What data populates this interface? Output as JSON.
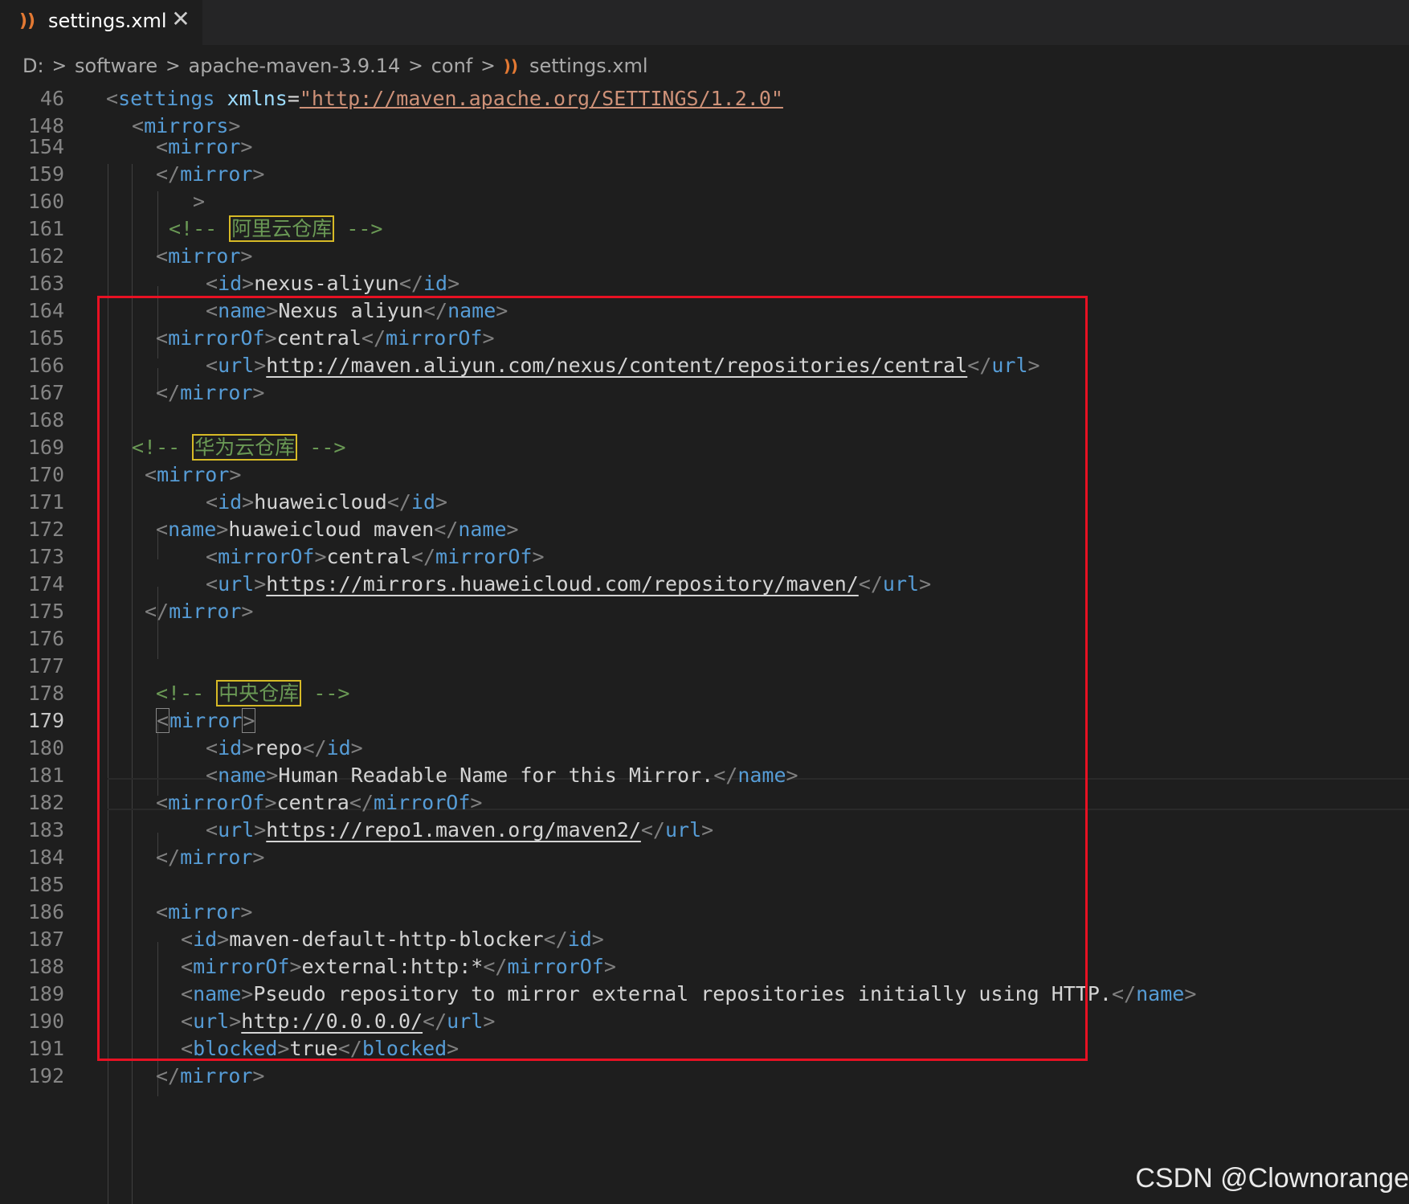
{
  "tab": {
    "icon": "rss-icon",
    "label": "settings.xml",
    "close": "✕"
  },
  "breadcrumb": {
    "parts": [
      "D:",
      "software",
      "apache-maven-3.9.14",
      "conf"
    ],
    "file": "settings.xml"
  },
  "lines": [
    {
      "n": "46"
    },
    {
      "n": "148"
    },
    {
      "n": "154"
    },
    {
      "n": "159"
    },
    {
      "n": "160"
    },
    {
      "n": "161"
    },
    {
      "n": "162"
    },
    {
      "n": "163"
    },
    {
      "n": "164"
    },
    {
      "n": "165"
    },
    {
      "n": "166"
    },
    {
      "n": "167"
    },
    {
      "n": "168"
    },
    {
      "n": "169"
    },
    {
      "n": "170"
    },
    {
      "n": "171"
    },
    {
      "n": "172"
    },
    {
      "n": "173"
    },
    {
      "n": "174"
    },
    {
      "n": "175"
    },
    {
      "n": "176"
    },
    {
      "n": "177"
    },
    {
      "n": "178"
    },
    {
      "n": "179"
    },
    {
      "n": "180"
    },
    {
      "n": "181"
    },
    {
      "n": "182"
    },
    {
      "n": "183"
    },
    {
      "n": "184"
    },
    {
      "n": "185"
    },
    {
      "n": "186"
    },
    {
      "n": "187"
    },
    {
      "n": "188"
    },
    {
      "n": "189"
    },
    {
      "n": "190"
    },
    {
      "n": "191"
    },
    {
      "n": "192"
    }
  ],
  "code": {
    "settings_tag": "settings",
    "xmlns_attr": "xmlns",
    "xmlns_value": "\"http://maven.apache.org/SETTINGS/1.2.0\"",
    "mirrors": "mirrors",
    "mirror": "mirror",
    "id": "id",
    "name": "name",
    "mirrorOf": "mirrorOf",
    "url": "url",
    "blocked": "blocked",
    "stray": ">",
    "comment_open": "<!-- ",
    "comment_close": " -->",
    "aliyun_comment": "阿里云仓库",
    "aliyun_id": "nexus-aliyun",
    "aliyun_name": "Nexus aliyun",
    "aliyun_of": "central",
    "aliyun_url": "http://maven.aliyun.com/nexus/content/repositories/central",
    "huawei_comment": "华为云仓库",
    "huawei_id": "huaweicloud",
    "huawei_name": "huaweicloud maven",
    "huawei_of": "central",
    "huawei_url": "https://mirrors.huaweicloud.com/repository/maven/",
    "central_comment": "中央仓库",
    "central_id": "repo",
    "central_name": "Human Readable Name for this Mirror.",
    "central_of": "centra",
    "central_url": "https://repo1.maven.org/maven2/",
    "blocker_id": "maven-default-http-blocker",
    "blocker_of": "external:http:*",
    "blocker_name": "Pseudo repository to mirror external repositories initially using HTTP.",
    "blocker_url": "http://0.0.0.0/",
    "blocker_blocked": "true"
  },
  "watermark": "CSDN @Clownorange",
  "colors": {
    "tag": "#569cd6",
    "punct": "#808080",
    "string": "#ce9178",
    "comment": "#6a9955",
    "highlight_border": "#d7ba26",
    "annotation_box": "#e81123"
  }
}
